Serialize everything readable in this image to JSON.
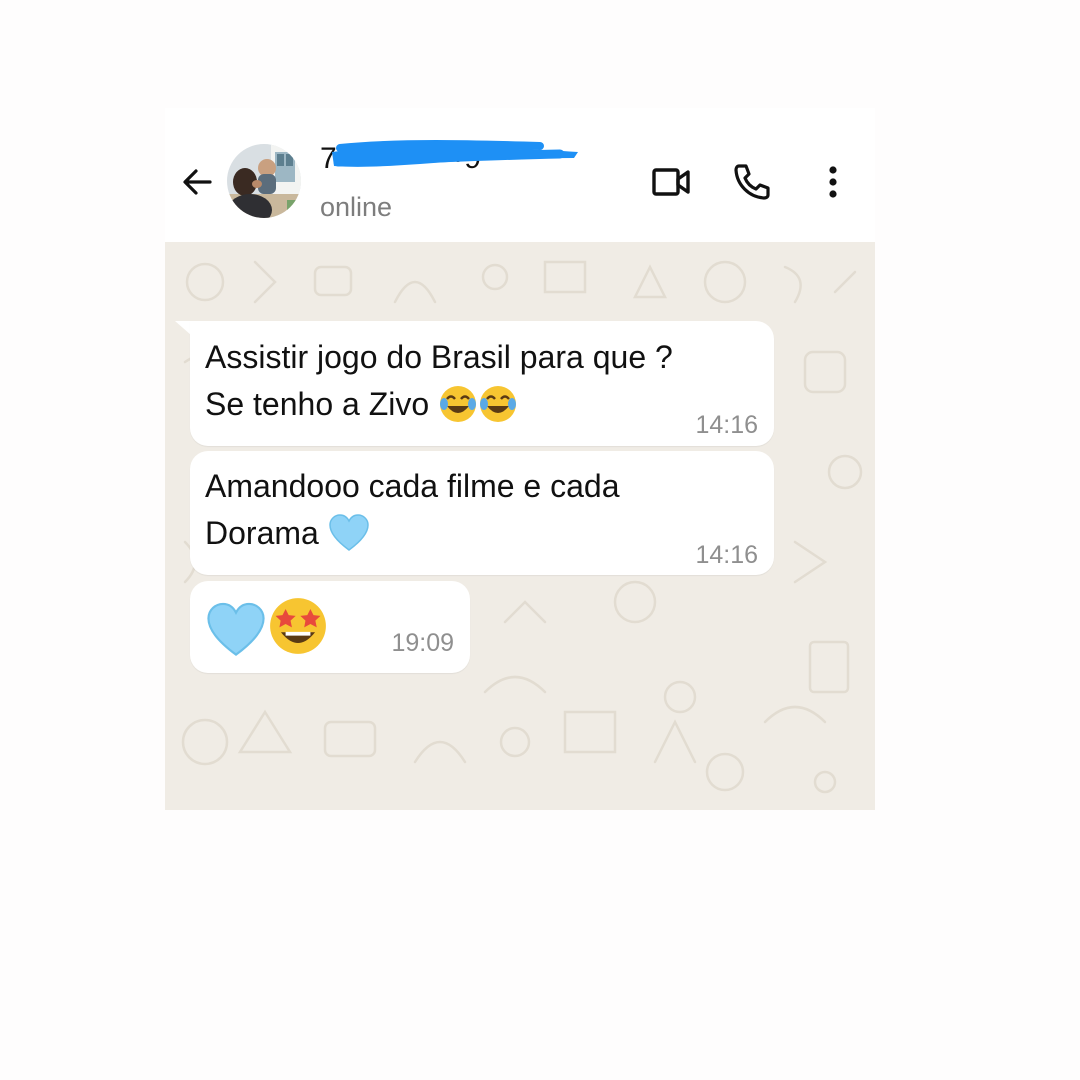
{
  "header": {
    "contact_name": "7•••••••••••9",
    "status": "online"
  },
  "icons": {
    "back": "arrow-left-icon",
    "video": "video-camera-icon",
    "call": "phone-icon",
    "menu": "more-vertical-icon"
  },
  "messages": [
    {
      "lines": [
        "Assistir jogo do Brasil para que ?",
        "Se tenho a Zivo"
      ],
      "emojis": [
        "face-with-tears-of-joy",
        "face-with-tears-of-joy"
      ],
      "time": "14:16"
    },
    {
      "lines": [
        "Amandooo cada filme e cada",
        "Dorama"
      ],
      "emojis": [
        "light-blue-heart"
      ],
      "time": "14:16"
    },
    {
      "lines": [
        ""
      ],
      "emojis": [
        "light-blue-heart",
        "star-struck"
      ],
      "time": "19:09"
    }
  ],
  "colors": {
    "header_bg": "#ffffff",
    "chat_bg": "#f0ece5",
    "bubble_bg": "#ffffff",
    "redaction": "#1e90f5",
    "time_text": "#8f8f8f",
    "status_text": "#7d7d7d"
  }
}
